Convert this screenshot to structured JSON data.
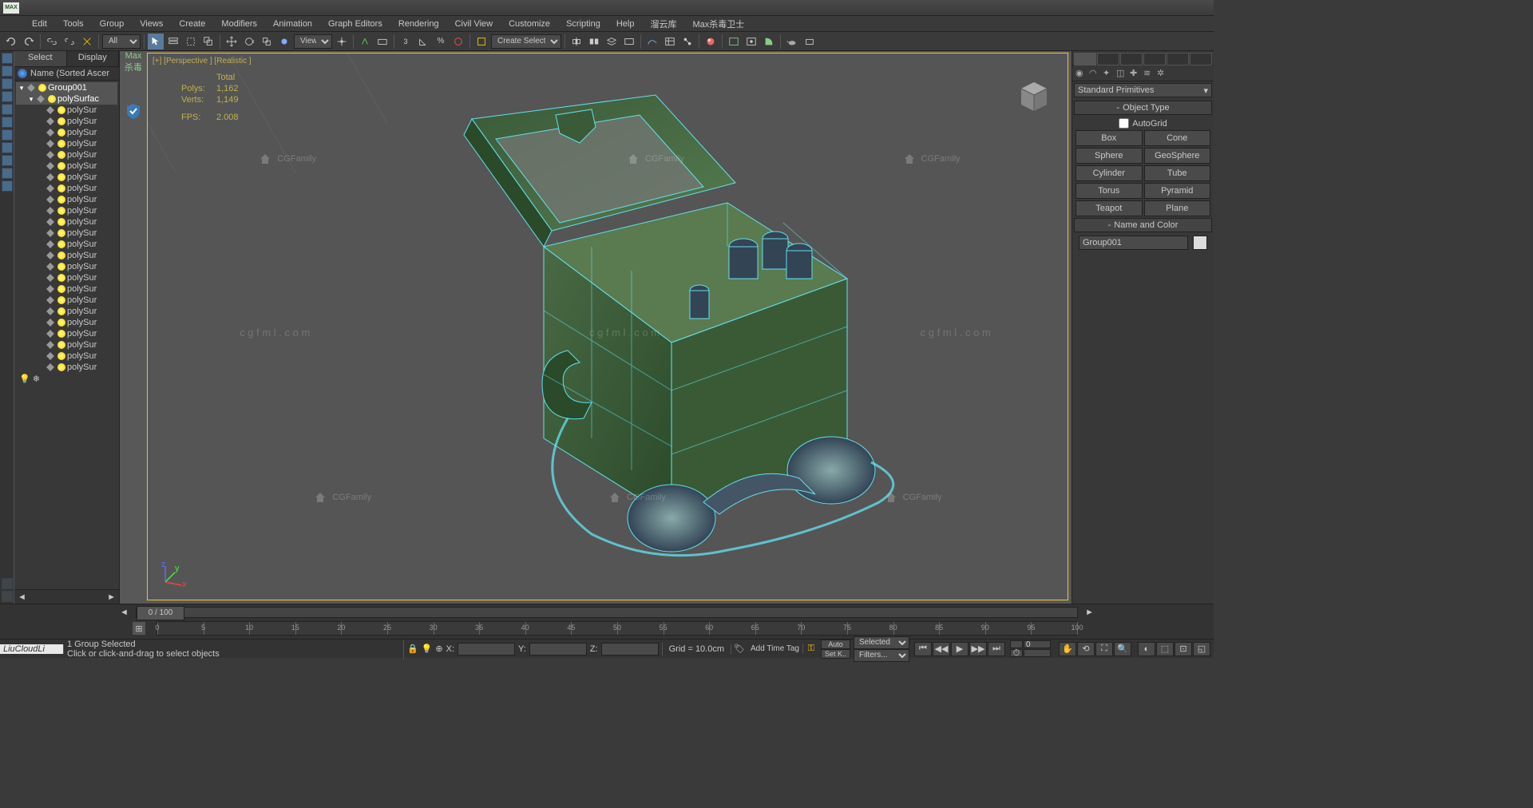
{
  "app": {
    "title": "MAX"
  },
  "menu": [
    "Edit",
    "Tools",
    "Group",
    "Views",
    "Create",
    "Modifiers",
    "Animation",
    "Graph Editors",
    "Rendering",
    "Civil View",
    "Customize",
    "Scripting",
    "Help",
    "溜云库",
    "Max杀毒卫士"
  ],
  "toolbar": {
    "dropdown1": "All",
    "dropdown2": "View",
    "dropdown3": "Create Selection Se"
  },
  "left": {
    "tab1": "Select",
    "tab2": "Display",
    "name_header": "Name (Sorted Ascer"
  },
  "tree": {
    "root": "Group001",
    "child": "polySurfac",
    "leaves": [
      "polySur",
      "polySur",
      "polySur",
      "polySur",
      "polySur",
      "polySur",
      "polySur",
      "polySur",
      "polySur",
      "polySur",
      "polySur",
      "polySur",
      "polySur",
      "polySur",
      "polySur",
      "polySur",
      "polySur",
      "polySur",
      "polySur",
      "polySur",
      "polySur",
      "polySur",
      "polySur",
      "polySur"
    ]
  },
  "security": {
    "label": "Max",
    "sub": "杀毒"
  },
  "viewport": {
    "label": "[+] [Perspective ] [Realistic ]"
  },
  "stats": {
    "h_total": "Total",
    "polys_l": "Polys:",
    "polys": "1,162",
    "verts_l": "Verts:",
    "verts": "1,149",
    "fps_l": "FPS:",
    "fps": "2.008"
  },
  "watermarks": {
    "cg": "CGFamily",
    "url": "c g f m l . c o m"
  },
  "cmdpanel": {
    "category": "Standard Primitives",
    "ot": "Object Type",
    "autogrid": "AutoGrid",
    "buttons": [
      "Box",
      "Cone",
      "Sphere",
      "GeoSphere",
      "Cylinder",
      "Tube",
      "Torus",
      "Pyramid",
      "Teapot",
      "Plane"
    ],
    "nc": "Name and Color",
    "name_value": "Group001"
  },
  "timeline": {
    "label": "0 / 100",
    "ticks": [
      "0",
      "5",
      "10",
      "15",
      "20",
      "25",
      "30",
      "35",
      "40",
      "45",
      "50",
      "55",
      "60",
      "65",
      "70",
      "75",
      "80",
      "85",
      "90",
      "95",
      "100"
    ]
  },
  "status": {
    "user": "LiuCloudLi",
    "sel": "1 Group Selected",
    "hint": "Click or click-and-drag to select objects",
    "x": "X:",
    "y": "Y:",
    "z": "Z:",
    "grid": "Grid = 10.0cm",
    "auto": "Auto",
    "setk": "Set K..",
    "selected": "Selected",
    "filters": "Filters...",
    "add_tag": "Add Time Tag"
  }
}
